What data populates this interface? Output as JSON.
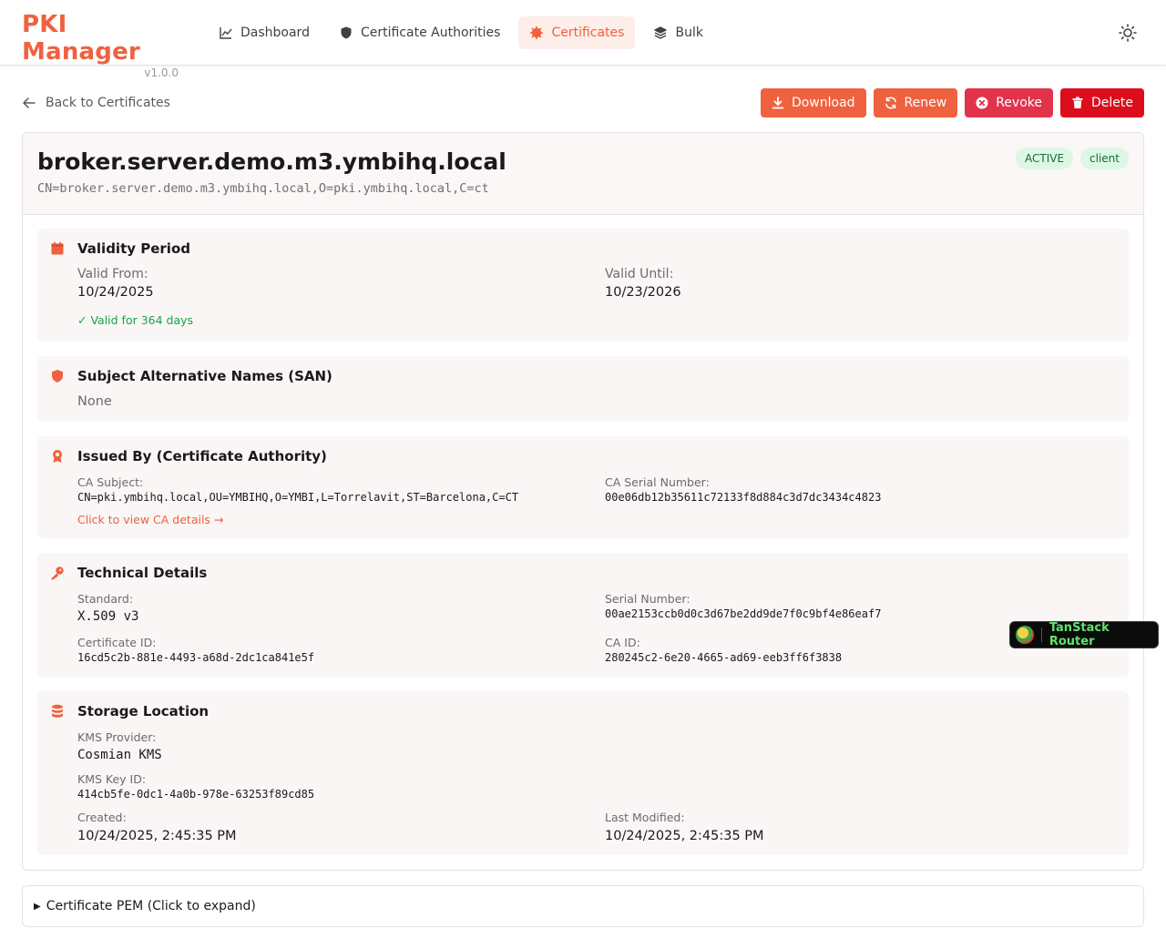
{
  "app": {
    "title": "PKI Manager",
    "version": "v1.0.0"
  },
  "nav": {
    "items": [
      {
        "label": "Dashboard",
        "icon": "chart-line-icon"
      },
      {
        "label": "Certificate Authorities",
        "icon": "shield-icon"
      },
      {
        "label": "Certificates",
        "icon": "certificate-icon",
        "active": true
      },
      {
        "label": "Bulk",
        "icon": "layers-icon"
      }
    ]
  },
  "theme_icon": "sun-icon",
  "back_label": "Back to Certificates",
  "actions": {
    "download": "Download",
    "renew": "Renew",
    "revoke": "Revoke",
    "delete": "Delete"
  },
  "certificate": {
    "common_name": "broker.server.demo.m3.ymbihq.local",
    "subject_dn": "CN=broker.server.demo.m3.ymbihq.local,O=pki.ymbihq.local,C=ct",
    "status_badge": "ACTIVE",
    "type_badge": "client"
  },
  "validity": {
    "title": "Validity Period",
    "from_label": "Valid From:",
    "from": "10/24/2025",
    "until_label": "Valid Until:",
    "until": "10/23/2026",
    "status": "✓ Valid for 364 days"
  },
  "san": {
    "title": "Subject Alternative Names (SAN)",
    "value": "None"
  },
  "issuer": {
    "title": "Issued By (Certificate Authority)",
    "ca_subject_label": "CA Subject:",
    "ca_subject": "CN=pki.ymbihq.local,OU=YMBIHQ,O=YMBI,L=Torrelavit,ST=Barcelona,C=CT",
    "ca_serial_label": "CA Serial Number:",
    "ca_serial": "00e06db12b35611c72133f8d884c3d7dc3434c4823",
    "link": "Click to view CA details →"
  },
  "technical": {
    "title": "Technical Details",
    "standard_label": "Standard:",
    "standard": "X.509 v3",
    "serial_label": "Serial Number:",
    "serial": "00ae2153ccb0d0c3d67be2dd9de7f0c9bf4e86eaf7",
    "cert_id_label": "Certificate ID:",
    "cert_id": "16cd5c2b-881e-4493-a68d-2dc1ca841e5f",
    "ca_id_label": "CA ID:",
    "ca_id": "280245c2-6e20-4665-ad69-eeb3ff6f3838"
  },
  "storage": {
    "title": "Storage Location",
    "kms_provider_label": "KMS Provider:",
    "kms_provider": "Cosmian KMS",
    "kms_key_label": "KMS Key ID:",
    "kms_key": "414cb5fe-0dc1-4a0b-978e-63253f89cd85",
    "created_label": "Created:",
    "created": "10/24/2025, 2:45:35 PM",
    "modified_label": "Last Modified:",
    "modified": "10/24/2025, 2:45:35 PM"
  },
  "pem": {
    "label": "Certificate PEM (Click to expand)"
  },
  "devtools": {
    "label": "TanStack Router"
  },
  "colors": {
    "brand": "#f0613f",
    "revoke": "#e2334b",
    "delete": "#dc0d1c",
    "success": "#16a34a",
    "badge_bg": "#dcf7e4"
  }
}
